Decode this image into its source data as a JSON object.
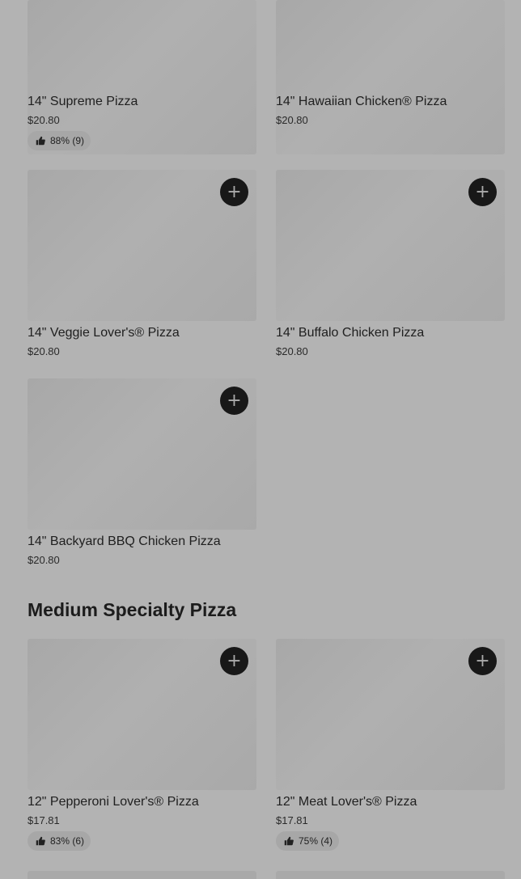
{
  "items": [
    {
      "name": "14\" Supreme Pizza",
      "price": "$20.80",
      "rating": "88% (9)"
    },
    {
      "name": "14\" Hawaiian Chicken® Pizza",
      "price": "$20.80"
    },
    {
      "name": "14\" Veggie Lover's® Pizza",
      "price": "$20.80",
      "add": "+"
    },
    {
      "name": "14\" Buffalo Chicken Pizza",
      "price": "$20.80",
      "add": "+"
    },
    {
      "name": "14\" Backyard BBQ Chicken Pizza",
      "price": "$20.80",
      "add": "+"
    }
  ],
  "section": {
    "title": "Medium Specialty Pizza"
  },
  "medium_items": [
    {
      "name": "12\" Pepperoni Lover's® Pizza",
      "price": "$17.81",
      "rating": "83% (6)",
      "add": "+"
    },
    {
      "name": "12\" Meat Lover's® Pizza",
      "price": "$17.81",
      "rating": "75% (4)",
      "add": "+"
    }
  ],
  "icons": {
    "add": "plus-icon",
    "rating": "thumbs-up-icon"
  }
}
